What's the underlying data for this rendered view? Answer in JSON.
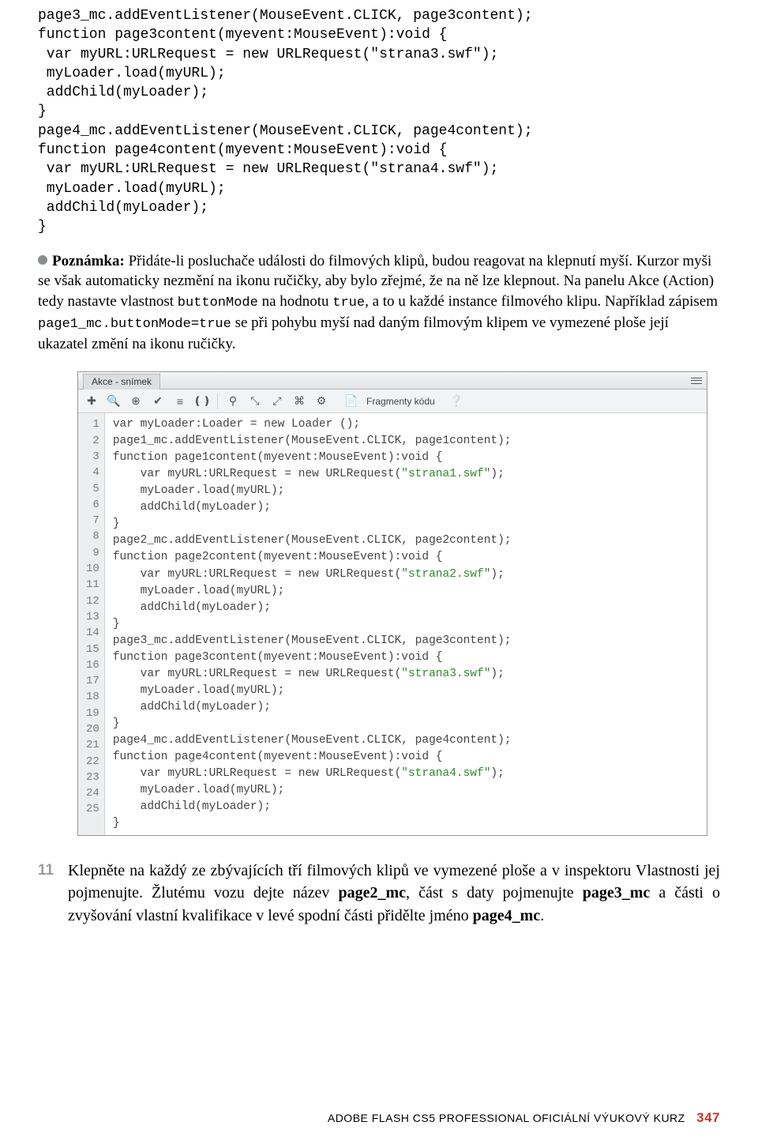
{
  "code_top": "page3_mc.addEventListener(MouseEvent.CLICK, page3content);\nfunction page3content(myevent:MouseEvent):void {\n var myURL:URLRequest = new URLRequest(\"strana3.swf\");\n myLoader.load(myURL);\n addChild(myLoader);\n}\npage4_mc.addEventListener(MouseEvent.CLICK, page4content);\nfunction page4content(myevent:MouseEvent):void {\n var myURL:URLRequest = new URLRequest(\"strana4.swf\");\n myLoader.load(myURL);\n addChild(myLoader);\n}",
  "note": {
    "label": "Poznámka:",
    "t1": " Přidáte-li posluchače události do filmových klipů, budou reagovat na klepnutí myší. Kurzor myši se však automaticky nezmění na ikonu ručičky, aby bylo zřejmé, že na ně lze klepnout. Na panelu Akce (Action) tedy nastavte vlastnost ",
    "m1": "buttonMode",
    "t2": " na hodnotu ",
    "m2": "true",
    "t3": ", a to u každé instance filmového klipu. Například zápisem ",
    "m3": "page1_mc.buttonMode=true",
    "t4": " se při pohybu myší nad daným filmovým klipem ve vymezené ploše její ukazatel změní na ikonu ručičky."
  },
  "panel": {
    "tab": "Akce - snímek",
    "frag": "Fragmenty kódu",
    "lines": [
      {
        "n": "1",
        "pre": "var myLoader:Loader = new Loader ();"
      },
      {
        "n": "2",
        "pre": "page1_mc.addEventListener(MouseEvent.CLICK, page1content);"
      },
      {
        "n": "3",
        "pre": "function page1content(myevent:MouseEvent):void {"
      },
      {
        "n": "4",
        "pre": "    var myURL:URLRequest = new URLRequest(",
        "str": "\"strana1.swf\"",
        "post": ");"
      },
      {
        "n": "5",
        "pre": "    myLoader.load(myURL);"
      },
      {
        "n": "6",
        "pre": "    addChild(myLoader);"
      },
      {
        "n": "7",
        "pre": "}"
      },
      {
        "n": "8",
        "pre": "page2_mc.addEventListener(MouseEvent.CLICK, page2content);"
      },
      {
        "n": "9",
        "pre": "function page2content(myevent:MouseEvent):void {"
      },
      {
        "n": "10",
        "pre": "    var myURL:URLRequest = new URLRequest(",
        "str": "\"strana2.swf\"",
        "post": ");"
      },
      {
        "n": "11",
        "pre": "    myLoader.load(myURL);"
      },
      {
        "n": "12",
        "pre": "    addChild(myLoader);"
      },
      {
        "n": "13",
        "pre": "}"
      },
      {
        "n": "14",
        "pre": "page3_mc.addEventListener(MouseEvent.CLICK, page3content);"
      },
      {
        "n": "15",
        "pre": "function page3content(myevent:MouseEvent):void {"
      },
      {
        "n": "16",
        "pre": "    var myURL:URLRequest = new URLRequest(",
        "str": "\"strana3.swf\"",
        "post": ");"
      },
      {
        "n": "17",
        "pre": "    myLoader.load(myURL);"
      },
      {
        "n": "18",
        "pre": "    addChild(myLoader);"
      },
      {
        "n": "19",
        "pre": "}"
      },
      {
        "n": "20",
        "pre": "page4_mc.addEventListener(MouseEvent.CLICK, page4content);"
      },
      {
        "n": "21",
        "pre": "function page4content(myevent:MouseEvent):void {"
      },
      {
        "n": "22",
        "pre": "    var myURL:URLRequest = new URLRequest(",
        "str": "\"strana4.swf\"",
        "post": ");"
      },
      {
        "n": "23",
        "pre": "    myLoader.load(myURL);"
      },
      {
        "n": "24",
        "pre": "    addChild(myLoader);"
      },
      {
        "n": "25",
        "pre": "}"
      }
    ]
  },
  "step": {
    "num": "11",
    "t1": "Klepněte na každý ze zbývajících tří filmových klipů ve vymezené ploše a v inspektoru Vlastnosti jej pojmenujte. Žlutému vozu dejte název ",
    "b1": "page2_mc",
    "t2": ", část s daty pojmenujte ",
    "b2": "page3_mc",
    "t3": " a části o zvyšování vlastní kvalifikace v levé spodní části přidělte jméno ",
    "b3": "page4_mc",
    "t4": "."
  },
  "footer": {
    "title": "ADOBE FLASH CS5 PROFESSIONAL OFICIÁLNÍ VÝUKOVÝ KURZ",
    "page": "347"
  }
}
